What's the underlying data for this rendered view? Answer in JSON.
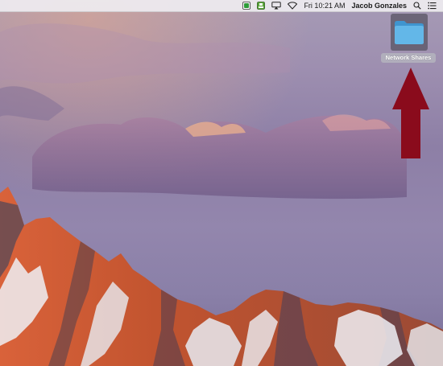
{
  "menubar": {
    "status_icons": [
      "green-status-icon",
      "menu-extra-icon",
      "airplay-icon",
      "wifi-icon"
    ],
    "clock": "Fri 10:21 AM",
    "user_name": "Jacob Gonzales",
    "right_icons": [
      "search-icon",
      "list-icon"
    ]
  },
  "desktop": {
    "folder_label": "Network Shares",
    "folder_color": "#63b7e8",
    "arrow_color": "#8a0b1c"
  }
}
